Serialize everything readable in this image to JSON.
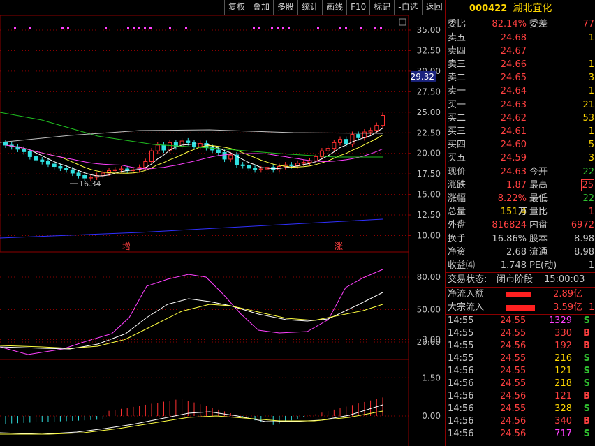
{
  "toolbar": [
    "复权",
    "叠加",
    "多股",
    "统计",
    "画线",
    "F10",
    "标记",
    "-自选",
    "返回"
  ],
  "stock": {
    "code": "000422",
    "name": "湖北宜化"
  },
  "price_axis": {
    "ticks": [
      "35.00",
      "32.50",
      "30.00",
      "27.50",
      "25.00",
      "22.50",
      "20.00",
      "17.50",
      "15.00",
      "12.50",
      "10.00"
    ],
    "marker": "29.32"
  },
  "low_label": "16.34",
  "markers": [
    {
      "text": "增"
    },
    {
      "text": "涨"
    }
  ],
  "osc_axis": [
    "80.00",
    "50.00",
    "20.00"
  ],
  "macd_axis": [
    "3.00",
    "1.50",
    "0.00"
  ],
  "order_ratio": {
    "label": "委比",
    "value": "82.14%",
    "label2": "委差",
    "value2": "77"
  },
  "asks": [
    {
      "label": "卖五",
      "price": "24.68",
      "vol": "1"
    },
    {
      "label": "卖四",
      "price": "24.67",
      "vol": ""
    },
    {
      "label": "卖三",
      "price": "24.66",
      "vol": "1"
    },
    {
      "label": "卖二",
      "price": "24.65",
      "vol": "3"
    },
    {
      "label": "卖一",
      "price": "24.64",
      "vol": "1"
    }
  ],
  "bids": [
    {
      "label": "买一",
      "price": "24.63",
      "vol": "21"
    },
    {
      "label": "买二",
      "price": "24.62",
      "vol": "53"
    },
    {
      "label": "买三",
      "price": "24.61",
      "vol": "1"
    },
    {
      "label": "买四",
      "price": "24.60",
      "vol": "5"
    },
    {
      "label": "买五",
      "price": "24.59",
      "vol": "3"
    }
  ],
  "stats": [
    {
      "l1": "现价",
      "v1": "24.63",
      "l2": "今开",
      "v2": "22"
    },
    {
      "l1": "涨跌",
      "v1": "1.87",
      "l2": "最高",
      "v2": "25"
    },
    {
      "l1": "涨幅",
      "v1": "8.22%",
      "l2": "最低",
      "v2": "22"
    },
    {
      "l1": "总量",
      "v1": "151.4",
      "u1": "万",
      "l2": "量比",
      "v2": "1"
    },
    {
      "l1": "外盘",
      "v1": "816824",
      "l2": "内盘",
      "v2": "6972"
    }
  ],
  "fin": [
    {
      "l1": "换手",
      "v1": "16.86%",
      "l2": "股本",
      "v2": "8.98"
    },
    {
      "l1": "净资",
      "v1": "2.68",
      "l2": "流通",
      "v2": "8.98"
    },
    {
      "l1": "收益⑷",
      "v1": "1.748",
      "l2": "PE(动)",
      "v2": "1"
    }
  ],
  "trade_status": {
    "label": "交易状态:",
    "state": "闭市阶段",
    "time": "15:00:03"
  },
  "flows": [
    {
      "label": "净流入额",
      "value": "2.89",
      "unit": "亿",
      "extra": ""
    },
    {
      "label": "大宗流入",
      "value": "3.59",
      "unit": "亿",
      "extra": "1"
    }
  ],
  "ticks": [
    {
      "time": "14:55",
      "price": "24.55",
      "vol": "1329",
      "dir": "S"
    },
    {
      "time": "14:55",
      "price": "24.55",
      "vol": "330",
      "dir": "B"
    },
    {
      "time": "14:55",
      "price": "24.56",
      "vol": "192",
      "dir": "B"
    },
    {
      "time": "14:55",
      "price": "24.55",
      "vol": "216",
      "dir": "S"
    },
    {
      "time": "14:56",
      "price": "24.55",
      "vol": "121",
      "dir": "S"
    },
    {
      "time": "14:56",
      "price": "24.55",
      "vol": "218",
      "dir": "S"
    },
    {
      "time": "14:56",
      "price": "24.56",
      "vol": "121",
      "dir": "B"
    },
    {
      "time": "14:56",
      "price": "24.55",
      "vol": "328",
      "dir": "S"
    },
    {
      "time": "14:56",
      "price": "24.56",
      "vol": "340",
      "dir": "B"
    },
    {
      "time": "14:56",
      "price": "24.56",
      "vol": "717",
      "dir": "S"
    }
  ],
  "colors": {
    "up": "#ff3030",
    "down": "#30e0e0",
    "grid": "#8b0000",
    "ma5": "#ffffff",
    "ma10": "#ffff40",
    "ma20": "#ff40ff",
    "ma60": "#20c020",
    "ma120": "#c0c0c0",
    "ma250": "#3030ff"
  }
}
